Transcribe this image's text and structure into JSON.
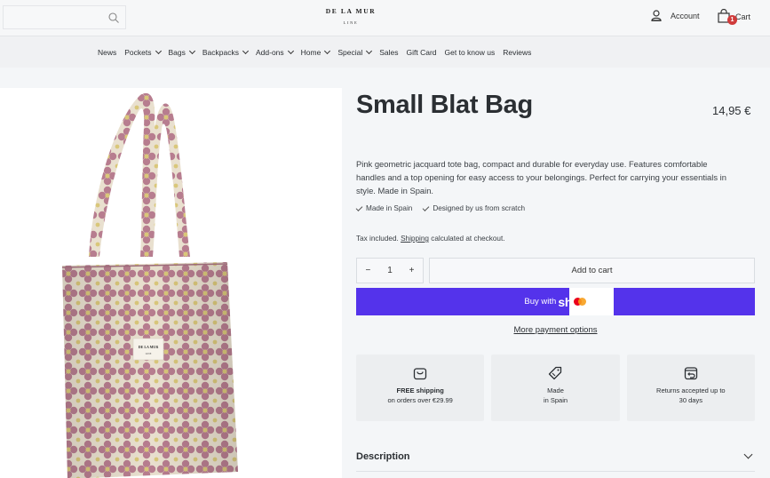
{
  "header": {
    "logo_main": "DE LA MUR",
    "logo_sub": "LINE",
    "account_label": "Account",
    "cart_label": "Cart",
    "cart_count": "1"
  },
  "nav": {
    "items": [
      {
        "label": "News",
        "dropdown": false
      },
      {
        "label": "Pockets",
        "dropdown": true
      },
      {
        "label": "Bags",
        "dropdown": true
      },
      {
        "label": "Backpacks",
        "dropdown": true
      },
      {
        "label": "Add-ons",
        "dropdown": true
      },
      {
        "label": "Home",
        "dropdown": true
      },
      {
        "label": "Special",
        "dropdown": true
      },
      {
        "label": "Sales",
        "dropdown": false
      },
      {
        "label": "Gift Card",
        "dropdown": false
      },
      {
        "label": "Get to know us",
        "dropdown": false
      },
      {
        "label": "Reviews",
        "dropdown": false
      }
    ]
  },
  "product": {
    "title": "Small Blat Bag",
    "price": "14,95 €",
    "description": "Pink geometric jacquard tote bag, compact and durable for everyday use. Features comfortable handles and a top opening for easy access to your belongings. Perfect for carrying your essentials in style. Made in Spain.",
    "features": [
      "Made in Spain",
      "Designed by us from scratch"
    ],
    "tax_prefix": "Tax included. ",
    "tax_link": "Shipping",
    "tax_suffix": " calculated at checkout.",
    "bag_label_main": "DE LA MUR",
    "bag_label_sub": "LINE"
  },
  "purchase": {
    "quantity": "1",
    "minus": "−",
    "plus": "+",
    "add_to_cart": "Add to cart",
    "buy_with": "Buy with",
    "shop_word": "shop",
    "more_payment": "More payment options"
  },
  "cards": [
    {
      "icon": "bag-icon",
      "line1": "FREE shipping",
      "line1_bold": true,
      "line2": "on orders over €29.99",
      "line2_bold": false
    },
    {
      "icon": "tag-icon",
      "line1": "Made",
      "line1_bold": false,
      "line2": "in Spain",
      "line2_bold": true
    },
    {
      "icon": "returns-icon",
      "line1": "Returns accepted up to",
      "line1_bold": false,
      "line2": "30 days",
      "line2_bold": true
    }
  ],
  "accordion": {
    "description_label": "Description"
  },
  "colors": {
    "shop_purple": "#5433eb",
    "badge_red": "#d03b3b",
    "bag_pink": "#b77d8f",
    "bag_beige": "#e9e0cf",
    "bag_yellow": "#d9c77a"
  }
}
